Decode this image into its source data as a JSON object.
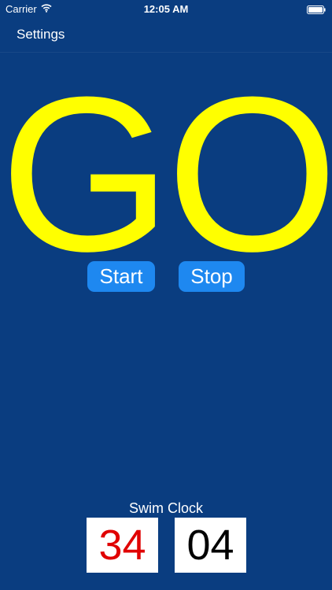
{
  "status_bar": {
    "carrier": "Carrier",
    "time": "12:05 AM",
    "wifi_icon": "wifi-icon",
    "battery_icon": "battery-icon"
  },
  "nav": {
    "settings_label": "Settings"
  },
  "signal": {
    "text": "GO",
    "color": "#ffff00"
  },
  "controls": {
    "start_label": "Start",
    "stop_label": "Stop",
    "button_color": "#1e88f0"
  },
  "swim_clock": {
    "title": "Swim Clock",
    "left_value": "34",
    "left_color": "#e00000",
    "right_value": "04",
    "right_color": "#000000"
  },
  "colors": {
    "background": "#0a3d80"
  }
}
